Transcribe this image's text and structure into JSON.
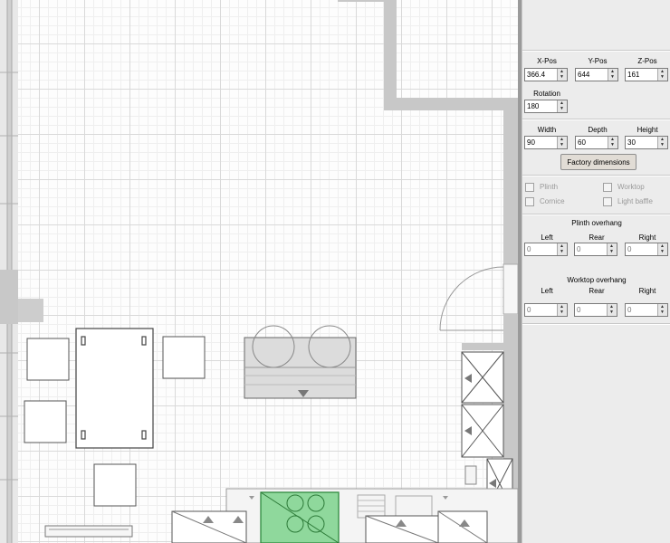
{
  "position": {
    "x_label": "X-Pos",
    "x_value": "366.4",
    "y_label": "Y-Pos",
    "y_value": "644",
    "z_label": "Z-Pos",
    "z_value": "161",
    "rotation_label": "Rotation",
    "rotation_value": "180"
  },
  "dimensions": {
    "width_label": "Width",
    "width_value": "90",
    "depth_label": "Depth",
    "depth_value": "60",
    "height_label": "Height",
    "height_value": "30",
    "factory_button": "Factory dimensions"
  },
  "options": {
    "plinth": "Plinth",
    "worktop": "Worktop",
    "cornice": "Cornice",
    "light_baffle": "Light baffle"
  },
  "plinth_overhang": {
    "title": "Plinth overhang",
    "left_label": "Left",
    "left_value": "0",
    "rear_label": "Rear",
    "rear_value": "0",
    "right_label": "Right",
    "right_value": "0"
  },
  "worktop_overhang": {
    "title": "Worktop overhang",
    "left_label": "Left",
    "left_value": "0",
    "rear_label": "Rear",
    "rear_value": "0",
    "right_label": "Right",
    "right_value": "0"
  },
  "colors": {
    "selected_unit": "#8fd89c",
    "wall": "#c8c8c8",
    "grid": "#d9d9d9"
  }
}
